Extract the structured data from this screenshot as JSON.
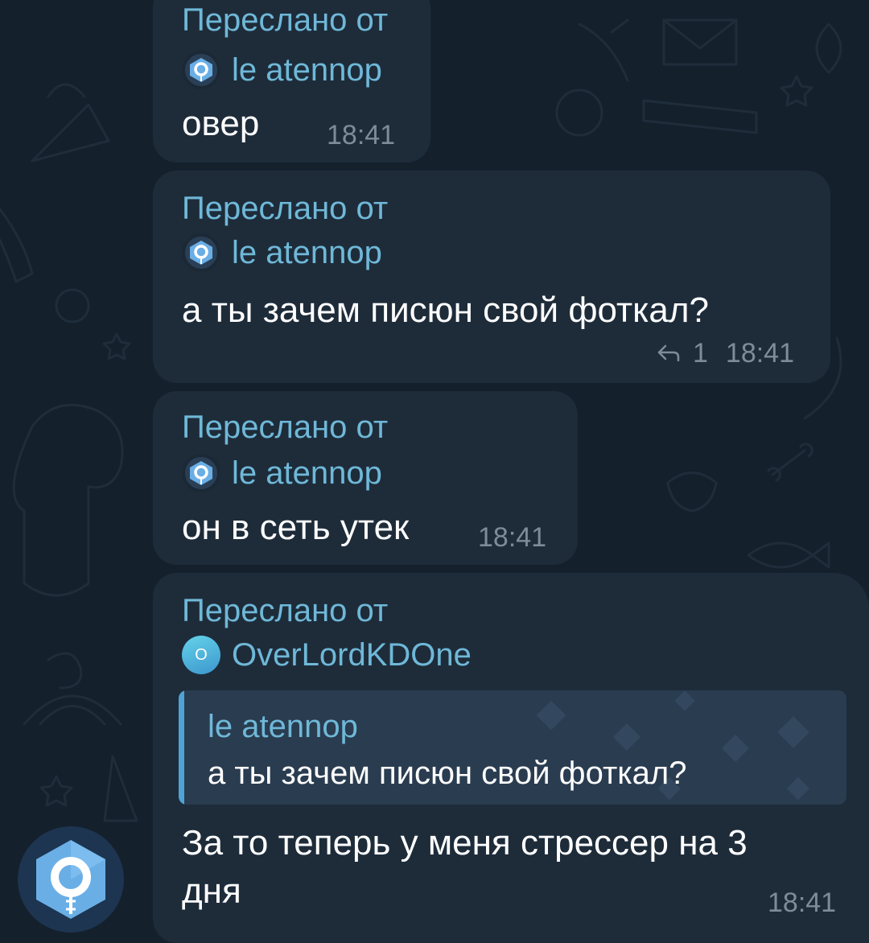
{
  "messages": [
    {
      "forward_label": "Переслано от",
      "source_name": "le atennop",
      "source_avatar_icon": "hexagon-logo-icon",
      "text": "овер",
      "time": "18:41"
    },
    {
      "forward_label": "Переслано от",
      "source_name": "le atennop",
      "source_avatar_icon": "hexagon-logo-icon",
      "text": "а ты зачем писюн свой фоткал?",
      "reply_count": "1",
      "time": "18:41"
    },
    {
      "forward_label": "Переслано от",
      "source_name": "le atennop",
      "source_avatar_icon": "hexagon-logo-icon",
      "text": "он в сеть утек",
      "time": "18:41"
    },
    {
      "forward_label": "Переслано от",
      "source_name": "OverLordKDOne",
      "source_avatar_letter": "O",
      "quote": {
        "name": "le atennop",
        "text": "а ты зачем писюн свой фоткал?"
      },
      "text_line1": "За то теперь у меня стрессер на 3",
      "text_line2": "дня",
      "time": "18:41"
    }
  ],
  "colors": {
    "background": "#14202c",
    "bubble": "#1e2c3a",
    "accent": "#6fb8d8",
    "text": "#ffffff",
    "meta": "#7e8c99"
  }
}
